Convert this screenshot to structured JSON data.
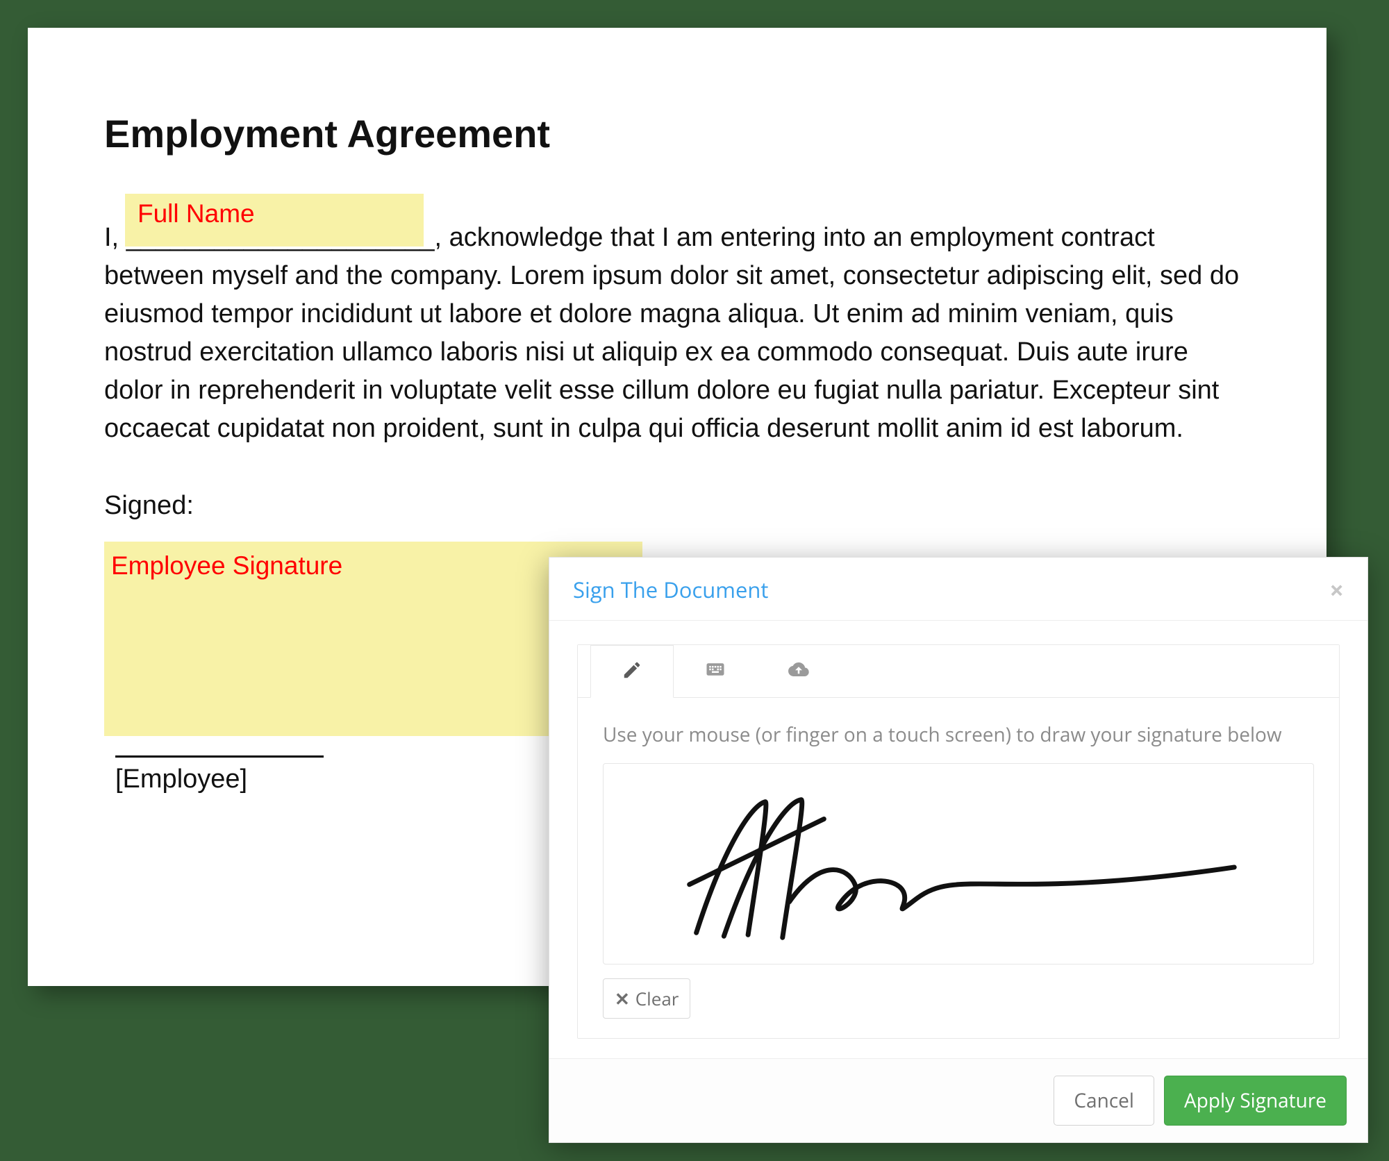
{
  "document": {
    "title": "Employment Agreement",
    "body_prefix": "I, ",
    "body_main": ", acknowledge that I am entering into an employment contract between myself and the company. Lorem ipsum dolor sit amet, consectetur adipiscing elit, sed do eiusmod tempor incididunt ut labore et dolore magna aliqua. Ut enim ad minim veniam, quis nostrud exercitation ullamco laboris nisi ut aliquip ex ea commodo consequat. Duis aute irure dolor in reprehenderit in voluptate velit esse cillum dolore eu fugiat nulla pariatur. Excepteur sint occaecat cupidatat non proident, sunt in culpa qui officia deserunt mollit anim id est laborum.",
    "full_name_label": "Full Name",
    "blank_line": "_____________________",
    "signed_label": "Signed:",
    "signature_label": "Employee Signature",
    "role_label": "[Employee]"
  },
  "modal": {
    "title": "Sign The Document",
    "instruction": "Use your mouse (or finger on a touch screen) to draw your signature below",
    "clear_label": "Clear",
    "cancel_label": "Cancel",
    "apply_label": "Apply Signature",
    "tabs": {
      "draw": "pen-icon",
      "type": "keyboard-icon",
      "upload": "cloud-icon"
    }
  }
}
